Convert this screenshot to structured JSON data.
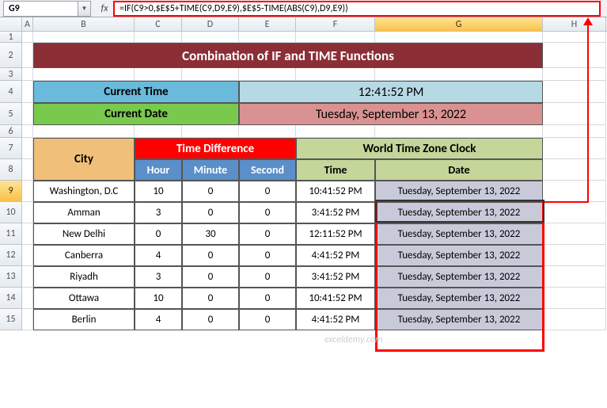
{
  "namebox": "G9",
  "formula": "=IF(C9>0,$E$5+TIME(C9,D9,E9),$E$5-TIME(ABS(C9),D9,E9))",
  "cols": [
    "A",
    "B",
    "C",
    "D",
    "E",
    "F",
    "G",
    "H"
  ],
  "rownums": [
    "1",
    "2",
    "3",
    "4",
    "5",
    "6",
    "7",
    "8",
    "9",
    "10",
    "11",
    "12",
    "13",
    "14",
    "15"
  ],
  "title": "Combination of IF and TIME Functions",
  "ct_label": "Current Time",
  "ct_value": "12:41:52 PM",
  "cd_label": "Current Date",
  "cd_value": "Tuesday, September 13, 2022",
  "hdr": {
    "city": "City",
    "timediff": "Time Difference",
    "world": "World Time Zone Clock",
    "hour": "Hour",
    "minute": "Minute",
    "second": "Second",
    "time": "Time",
    "date": "Date"
  },
  "rows": [
    {
      "city": "Washington, D.C",
      "h": "10",
      "m": "0",
      "s": "0",
      "time": "10:41:52 PM",
      "date": "Tuesday, September 13, 2022"
    },
    {
      "city": "Amman",
      "h": "3",
      "m": "0",
      "s": "0",
      "time": "3:41:52 PM",
      "date": "Tuesday, September 13, 2022"
    },
    {
      "city": "New Delhi",
      "h": "0",
      "m": "30",
      "s": "0",
      "time": "12:11:52 PM",
      "date": "Tuesday, September 13, 2022"
    },
    {
      "city": "Canberra",
      "h": "4",
      "m": "0",
      "s": "0",
      "time": "4:41:52 PM",
      "date": "Tuesday, September 13, 2022"
    },
    {
      "city": "Riyadh",
      "h": "3",
      "m": "0",
      "s": "0",
      "time": "3:41:52 PM",
      "date": "Tuesday, September 13, 2022"
    },
    {
      "city": "Ottawa",
      "h": "10",
      "m": "0",
      "s": "0",
      "time": "10:41:52 PM",
      "date": "Tuesday, September 13, 2022"
    },
    {
      "city": "Berlin",
      "h": "4",
      "m": "0",
      "s": "0",
      "time": "4:41:52 PM",
      "date": "Tuesday, September 13, 2022"
    }
  ],
  "watermark": "exceldemy.com"
}
